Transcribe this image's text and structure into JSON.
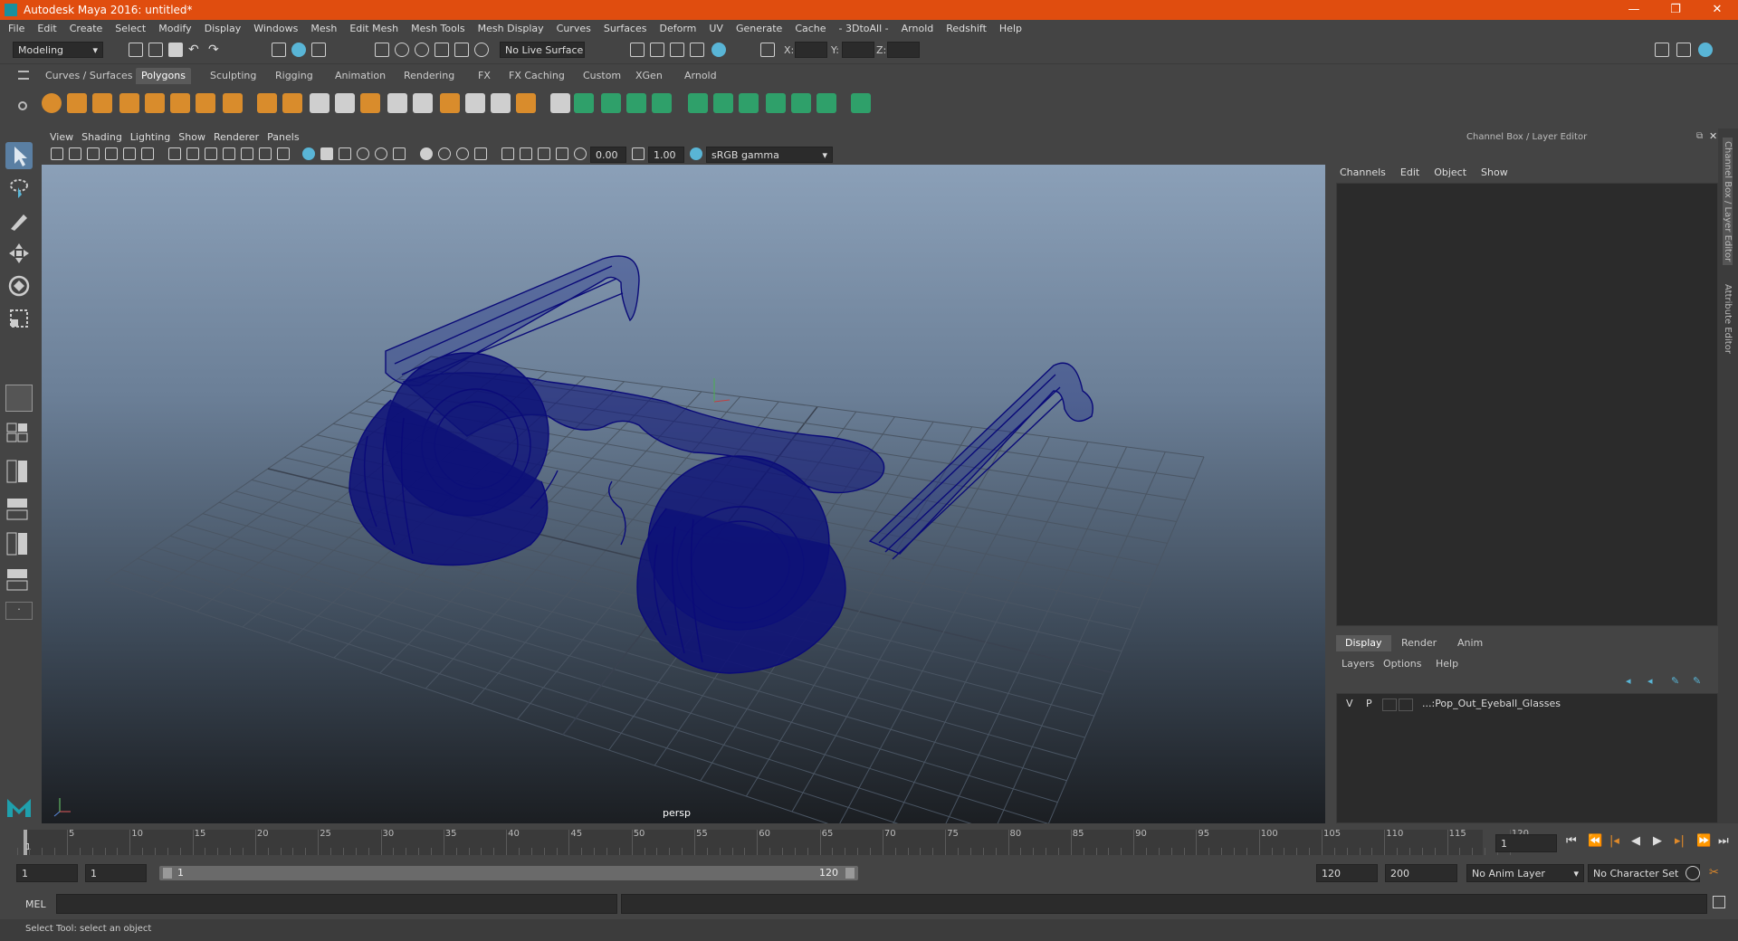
{
  "title": "Autodesk Maya 2016: untitled*",
  "window_controls": {
    "minimize": "—",
    "maximize": "❐",
    "close": "✕"
  },
  "menubar": [
    "File",
    "Edit",
    "Create",
    "Select",
    "Modify",
    "Display",
    "Windows",
    "Mesh",
    "Edit Mesh",
    "Mesh Tools",
    "Mesh Display",
    "Curves",
    "Surfaces",
    "Deform",
    "UV",
    "Generate",
    "Cache",
    "- 3DtoAll -",
    "Arnold",
    "Redshift",
    "Help"
  ],
  "statusline": {
    "mode": "Modeling",
    "live_surface": "No Live Surface",
    "x_label": "X:",
    "y_label": "Y:",
    "z_label": "Z:"
  },
  "shelf_tabs": [
    "Curves / Surfaces",
    "Polygons",
    "Sculpting",
    "Rigging",
    "Animation",
    "Rendering",
    "FX",
    "FX Caching",
    "Custom",
    "XGen",
    "Arnold"
  ],
  "shelf_active": "Polygons",
  "viewport_menu": [
    "View",
    "Shading",
    "Lighting",
    "Show",
    "Renderer",
    "Panels"
  ],
  "viewport_toolbar": {
    "exposure": "0.00",
    "gamma": "1.00",
    "color_space": "sRGB gamma"
  },
  "viewport_label": "persp",
  "channel_box": {
    "title": "Channel Box / Layer Editor",
    "menu": [
      "Channels",
      "Edit",
      "Object",
      "Show"
    ]
  },
  "layer_editor": {
    "tabs": [
      "Display",
      "Render",
      "Anim"
    ],
    "active_tab": "Display",
    "menu": [
      "Layers",
      "Options",
      "Help"
    ],
    "layer": {
      "v": "V",
      "p": "P",
      "name": "...:Pop_Out_Eyeball_Glasses"
    }
  },
  "side_tabs": [
    "Channel Box / Layer Editor",
    "Attribute Editor"
  ],
  "timeline": {
    "ticks": [
      "5",
      "10",
      "15",
      "20",
      "25",
      "30",
      "35",
      "40",
      "45",
      "50",
      "55",
      "60",
      "65",
      "70",
      "75",
      "80",
      "85",
      "90",
      "95",
      "100",
      "105",
      "110",
      "115",
      "120"
    ],
    "start_tick": "1",
    "current_frame": "1"
  },
  "range": {
    "start": "1",
    "anim_start": "1",
    "slider_start": "1",
    "slider_end": "120",
    "end": "120",
    "anim_end": "200",
    "anim_layer": "No Anim Layer",
    "character_set": "No Character Set"
  },
  "command_line": {
    "label": "MEL"
  },
  "help_line": "Select Tool: select an object",
  "colors": {
    "title_bar": "#e04d0f",
    "wireframe": "#0a0a78",
    "accent": "#59b5d6"
  }
}
